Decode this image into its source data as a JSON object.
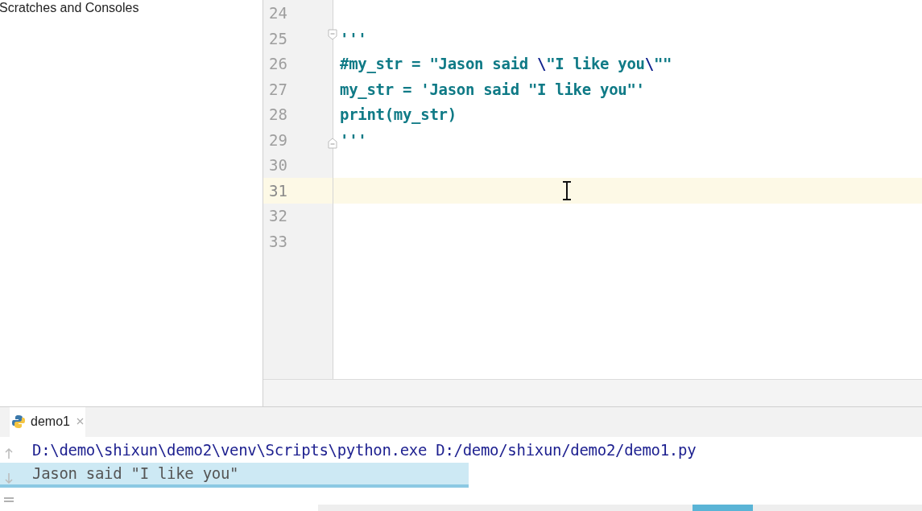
{
  "project_panel": {
    "title": "Scratches and Consoles"
  },
  "editor": {
    "lines": [
      {
        "number": "24",
        "current": false
      },
      {
        "number": "25",
        "current": false,
        "fold_start": true,
        "tokens": [
          {
            "text": "'''",
            "kind": "string"
          }
        ]
      },
      {
        "number": "26",
        "current": false,
        "tokens": [
          {
            "text": "#my_str = \"Jason said ",
            "kind": "string"
          },
          {
            "text": "\\",
            "kind": "escape"
          },
          {
            "text": "\"I like you",
            "kind": "string"
          },
          {
            "text": "\\",
            "kind": "escape"
          },
          {
            "text": "\"\"",
            "kind": "string"
          }
        ]
      },
      {
        "number": "27",
        "current": false,
        "tokens": [
          {
            "text": "my_str = 'Jason said \"I like you\"'",
            "kind": "string"
          }
        ]
      },
      {
        "number": "28",
        "current": false,
        "tokens": [
          {
            "text": "print(my_str)",
            "kind": "string"
          }
        ]
      },
      {
        "number": "29",
        "current": false,
        "fold_end": true,
        "tokens": [
          {
            "text": "'''",
            "kind": "string"
          }
        ]
      },
      {
        "number": "30",
        "current": false
      },
      {
        "number": "31",
        "current": true
      },
      {
        "number": "32",
        "current": false
      },
      {
        "number": "33",
        "current": false
      }
    ]
  },
  "run_panel": {
    "tabs": [
      {
        "label": "demo1",
        "selected": true
      }
    ],
    "output": [
      {
        "kind": "command",
        "text": "D:\\demo\\shixun\\demo2\\venv\\Scripts\\python.exe D:/demo/shixun/demo2/demo1.py",
        "selected": false
      },
      {
        "kind": "output",
        "text": "Jason said \"I like you\"",
        "selected": true
      }
    ]
  }
}
